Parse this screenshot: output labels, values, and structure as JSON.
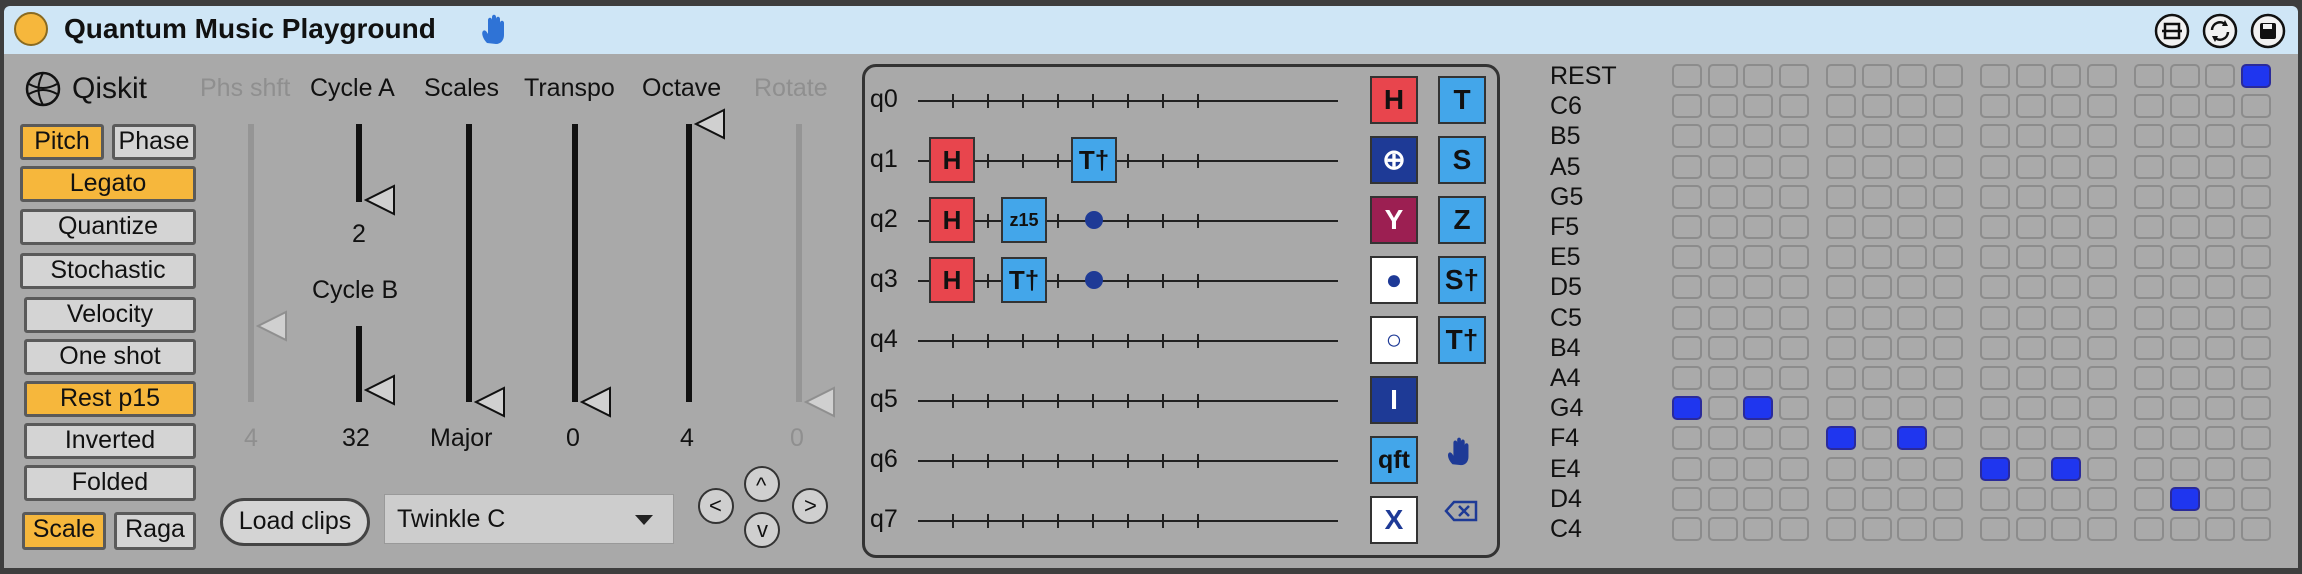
{
  "title": "Quantum Music Playground",
  "colors": {
    "titlebar": "#cfe6f6",
    "panel": "#a9a9a9",
    "toggle_on": "#f6b73c",
    "gate_h": "#e8454d",
    "gate_blue": "#43a6ea",
    "gate_navy": "#1e3a96",
    "gate_y": "#9c1f52",
    "cell_on": "#1f36ef",
    "title_dot": "#f6b73c"
  },
  "titlebar_icons": [
    "hand-icon",
    "window-icon",
    "refresh-icon",
    "save-icon"
  ],
  "left": {
    "brand": "Qiskit",
    "buttons": {
      "pitch": "Pitch",
      "phase": "Phase",
      "legato": "Legato",
      "quantize": "Quantize",
      "stochastic": "Stochastic",
      "velocity": "Velocity",
      "one_shot": "One shot",
      "rest": "Rest p15",
      "inverted": "Inverted",
      "folded": "Folded",
      "scale": "Scale",
      "raga": "Raga"
    },
    "toggled": [
      "pitch",
      "legato",
      "rest",
      "scale"
    ]
  },
  "sliders": {
    "phs_shft": {
      "label": "Phs shft",
      "value": "4",
      "level": 0.3
    },
    "cycle_a": {
      "label": "Cycle A",
      "value": "2",
      "level": 0.0
    },
    "cycle_b": {
      "label": "Cycle B",
      "value": "32",
      "level": 0.1
    },
    "scales": {
      "label": "Scales",
      "value": "Major",
      "level": 0.0
    },
    "transpo": {
      "label": "Transpo",
      "value": "0",
      "level": 0.0
    },
    "octave": {
      "label": "Octave",
      "value": "4",
      "level": 1.0
    },
    "rotate": {
      "label": "Rotate",
      "value": "0",
      "level": 0.0
    }
  },
  "load_clips": "Load clips",
  "clip_select": "Twinkle C",
  "nav": {
    "left": "<",
    "up": "^",
    "right": ">",
    "down": "v"
  },
  "circuit": {
    "qubits": [
      "q0",
      "q1",
      "q2",
      "q3",
      "q4",
      "q5",
      "q6",
      "q7"
    ],
    "gates": [
      {
        "qubit": 1,
        "column": 0,
        "label": "H",
        "kind": "h"
      },
      {
        "qubit": 1,
        "column": 2,
        "label": "T†",
        "kind": "blue"
      },
      {
        "qubit": 2,
        "column": 0,
        "label": "H",
        "kind": "h"
      },
      {
        "qubit": 2,
        "column": 1,
        "label": "z15",
        "kind": "blue-small"
      },
      {
        "qubit": 2,
        "column": 2,
        "label": "",
        "kind": "control"
      },
      {
        "qubit": 3,
        "column": 0,
        "label": "H",
        "kind": "h"
      },
      {
        "qubit": 3,
        "column": 1,
        "label": "T†",
        "kind": "blue"
      },
      {
        "qubit": 3,
        "column": 2,
        "label": "",
        "kind": "control"
      }
    ]
  },
  "palette": {
    "col1": [
      "H",
      "⊕",
      "Y",
      "●",
      "○",
      "I",
      "qft",
      "X"
    ],
    "col2": [
      "T",
      "S",
      "Z",
      "S†",
      "T†"
    ]
  },
  "grid": {
    "notes": [
      "REST",
      "C6",
      "B5",
      "A5",
      "G5",
      "F5",
      "E5",
      "D5",
      "C5",
      "B4",
      "A4",
      "G4",
      "F4",
      "E4",
      "D4",
      "C4"
    ],
    "active": [
      [
        0,
        15
      ],
      [
        11,
        0
      ],
      [
        11,
        2
      ],
      [
        12,
        4
      ],
      [
        12,
        6
      ],
      [
        13,
        8
      ],
      [
        13,
        10
      ],
      [
        14,
        13
      ]
    ]
  }
}
